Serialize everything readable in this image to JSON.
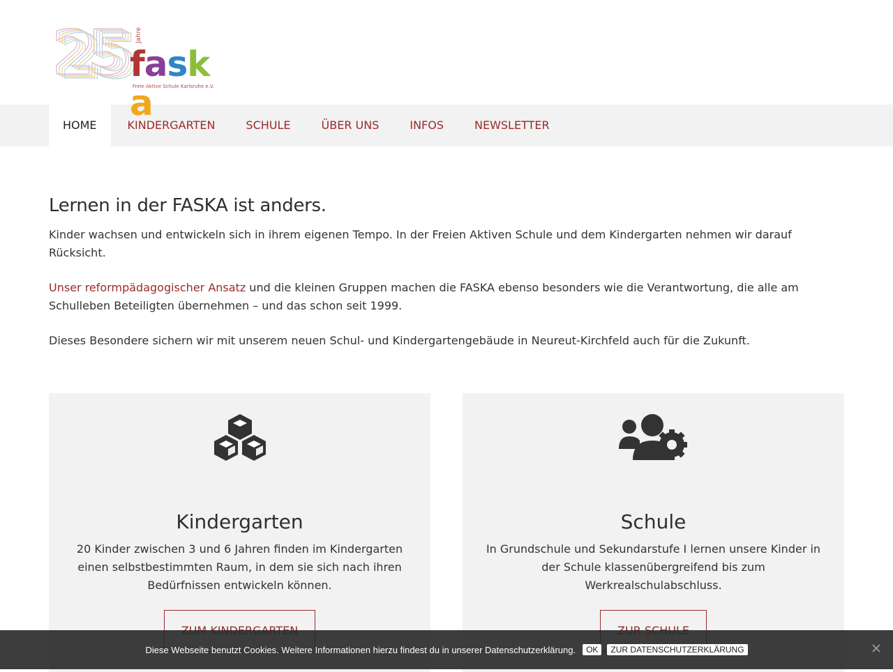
{
  "logo": {
    "number": "25",
    "jahre": "Jahre",
    "word_letters": [
      {
        "char": "f",
        "color": "#b03636"
      },
      {
        "char": "a",
        "color": "#8a3e9a"
      },
      {
        "char": "s",
        "color": "#2f86c7"
      },
      {
        "char": "k",
        "color": "#8bbf3a"
      },
      {
        "char": "a",
        "color": "#f0a81e"
      }
    ],
    "subtitle": "Freie Aktive Schule Karlsruhe e.V."
  },
  "nav": {
    "items": [
      {
        "label": "HOME",
        "active": true
      },
      {
        "label": "KINDERGARTEN",
        "active": false
      },
      {
        "label": "SCHULE",
        "active": false
      },
      {
        "label": "ÜBER UNS",
        "active": false
      },
      {
        "label": "INFOS",
        "active": false
      },
      {
        "label": "NEWSLETTER",
        "active": false
      }
    ]
  },
  "intro": {
    "heading": "Lernen in der FASKA ist anders.",
    "p1": "Kinder wachsen und entwickeln sich in ihrem eigenen Tempo. In der Freien Aktiven Schule und dem Kindergarten nehmen wir darauf Rücksicht.",
    "p2_link": "Unser reformpädagogischer Ansatz",
    "p2_rest": " und die kleinen Gruppen machen die FASKA ebenso besonders wie die Verantwortung, die alle am Schulleben Beteiligten übernehmen – und das schon seit 1999.",
    "p3": "Dieses Besondere sichern wir mit unserem neuen Schul- und Kindergartengebäude in Neureut-Kirchfeld auch für die Zukunft."
  },
  "cards": [
    {
      "icon": "cubes-icon",
      "title": "Kindergarten",
      "text": "20 Kinder zwischen 3 und 6 Jahren finden im Kindergarten einen selbstbestimmten Raum, in dem sie sich nach ihren Bedürfnissen entwickeln können.",
      "button": "ZUM KINDERGARTEN"
    },
    {
      "icon": "users-cog-icon",
      "title": "Schule",
      "text": "In Grundschule und Sekundarstufe I lernen unsere Kinder in der Schule klassenübergreifend bis zum Werkrealschulabschluss.",
      "button": "ZUR SCHULE"
    }
  ],
  "cookie": {
    "text": "Diese Webseite benutzt Cookies. Weitere Informationen hierzu findest du in unserer Datenschutzerklärung.",
    "ok_label": "OK",
    "policy_label": "ZUR DATENSCHUTZERKLÄRUNG"
  },
  "colors": {
    "accent": "#9b2a2a",
    "nav_bg": "#f2f2f2",
    "card_bg": "#f2f2f2",
    "text": "#333333"
  }
}
